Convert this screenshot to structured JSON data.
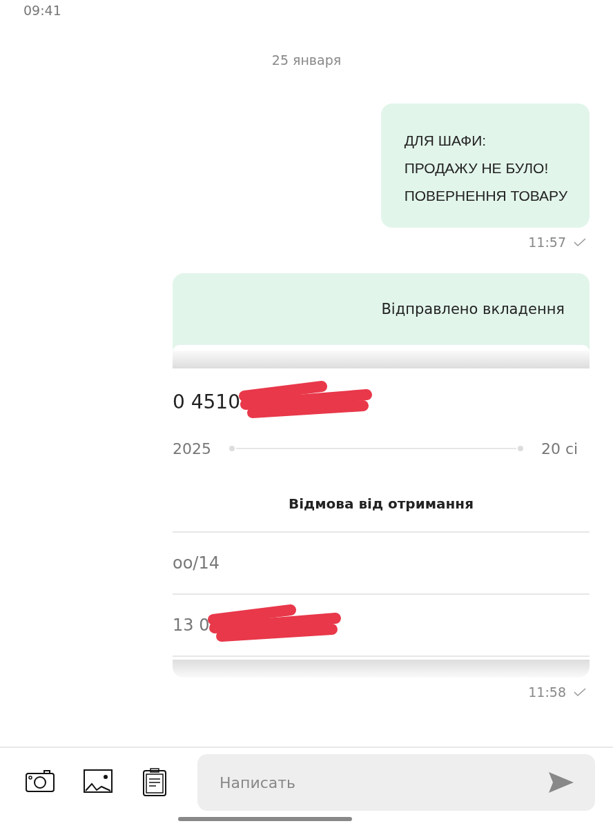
{
  "status_bar": {
    "time": "09:41"
  },
  "date_separator": "25 января",
  "messages": [
    {
      "kind": "text",
      "lines": [
        "ДЛЯ ШАФИ:",
        "ПРОДАЖУ НЕ БУЛО!",
        "ПОВЕРНЕННЯ ТОВАРУ"
      ],
      "time": "11:57",
      "delivered": true
    },
    {
      "kind": "attachment",
      "caption": "Відправлено вкладення",
      "attachment": {
        "tracking": {
          "text": "0 4510",
          "redacted": true
        },
        "date_from": "2025",
        "date_to": "20 сі",
        "status": "Відмова від отримання",
        "rows": [
          {
            "text": "оо/14",
            "redacted": false
          },
          {
            "text": "13 0",
            "redacted": true
          }
        ]
      },
      "time": "11:58",
      "delivered": true
    }
  ],
  "composer": {
    "placeholder": "Написать"
  }
}
